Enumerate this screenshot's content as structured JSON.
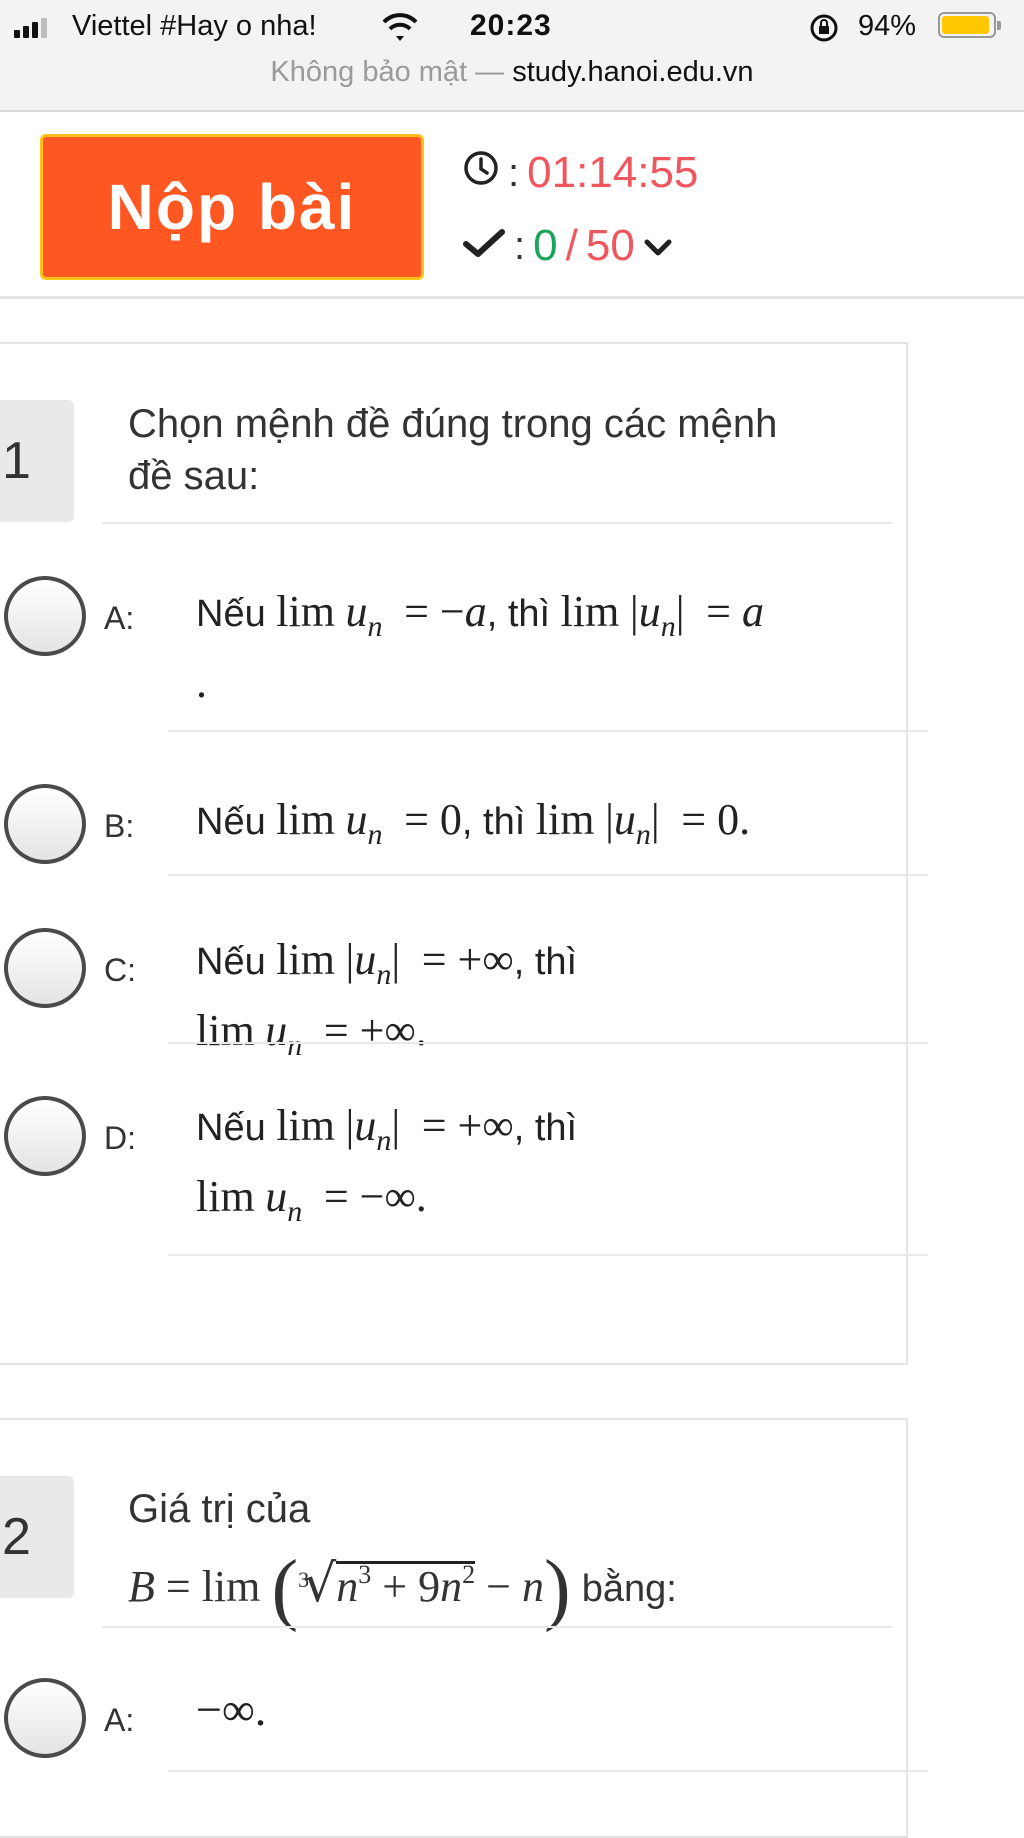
{
  "status_bar": {
    "carrier": "Viettel #Hay o nha!",
    "time": "20:23",
    "battery_percent": "94%",
    "battery_level": 0.94,
    "url_security": "Không bảo mật —",
    "url_host": "study.hanoi.edu.vn"
  },
  "toolbar": {
    "submit_label": "Nộp bài",
    "timer_sep": ":",
    "timer_value": "01:14:55",
    "progress_sep": ":",
    "answered": "0",
    "slash": "/",
    "total": "50"
  },
  "questions": [
    {
      "number": "1",
      "text_line1": "Chọn mệnh đề đúng trong các mệnh",
      "text_line2": "đề sau:",
      "options": {
        "a": {
          "letter": "A:"
        },
        "b": {
          "letter": "B:"
        },
        "c": {
          "letter": "C:"
        },
        "d": {
          "letter": "D:"
        }
      },
      "words": {
        "if": "Nếu",
        "then": "thì",
        "lim": "lim"
      }
    },
    {
      "number": "2",
      "text_line1": "Giá trị của",
      "text_suffix": "bằng:",
      "options": {
        "a": {
          "letter": "A:",
          "text": "−∞."
        }
      }
    }
  ]
}
